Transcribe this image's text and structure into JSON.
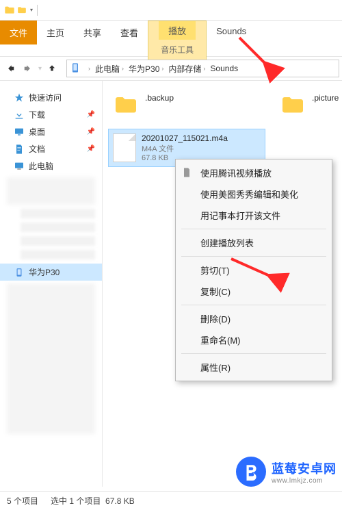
{
  "window": {
    "title": "Sounds"
  },
  "ribbon": {
    "file": "文件",
    "home": "主页",
    "share": "共享",
    "view": "查看",
    "play_group": "播放",
    "music_tools": "音乐工具",
    "title_tab": "Sounds"
  },
  "address": {
    "crumbs": [
      "此电脑",
      "华为P30",
      "内部存储",
      "Sounds"
    ]
  },
  "sidebar": {
    "items": [
      {
        "label": "快速访问",
        "icon": "star"
      },
      {
        "label": "下载",
        "icon": "download",
        "pinned": true
      },
      {
        "label": "桌面",
        "icon": "desktop",
        "pinned": true
      },
      {
        "label": "文档",
        "icon": "document",
        "pinned": true
      },
      {
        "label": "此电脑",
        "icon": "pc"
      }
    ],
    "selected": {
      "label": "华为P30",
      "icon": "phone"
    }
  },
  "files": {
    "folder1": {
      "name": ".backup"
    },
    "folder2": {
      "name": ".picture"
    },
    "selected": {
      "name": "20201027_115021.m4a",
      "type": "M4A 文件",
      "size": "67.8 KB"
    }
  },
  "context_menu": {
    "items": [
      {
        "label": "使用腾讯视频播放",
        "icon": true,
        "bold": true
      },
      {
        "label": "使用美图秀秀编辑和美化"
      },
      {
        "label": "用记事本打开该文件"
      }
    ],
    "playlist": "创建播放列表",
    "cut": "剪切(T)",
    "copy": "复制(C)",
    "delete": "删除(D)",
    "rename": "重命名(M)",
    "properties": "属性(R)"
  },
  "status": {
    "count": "5 个项目",
    "selection": "选中 1 个项目",
    "size": "67.8 KB"
  },
  "watermark": {
    "brand": "蓝莓安卓网",
    "url": "www.lmkjz.com"
  }
}
